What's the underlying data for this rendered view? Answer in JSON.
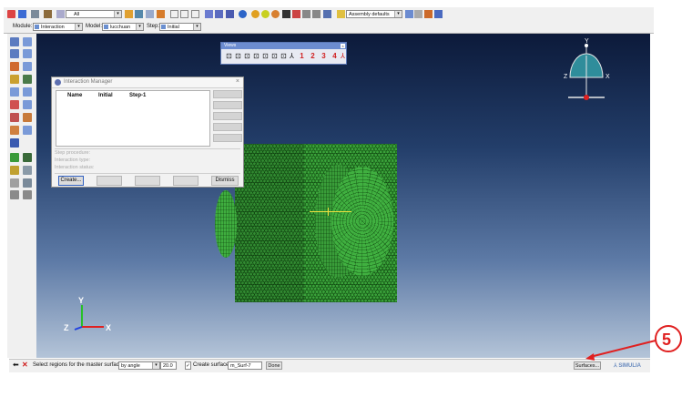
{
  "toolbar": {
    "filter_value": "All",
    "assembly_combo": "Assembly defaults"
  },
  "context_bar": {
    "module_label": "Module:",
    "module_value": "Interaction",
    "model_label": "Model:",
    "model_value": "lucchuan",
    "step_label": "Step:",
    "step_value": "Initial"
  },
  "views_toolbar": {
    "title": "Views",
    "buttons": [
      "1",
      "2",
      "3",
      "4"
    ]
  },
  "interaction_manager": {
    "title": "Interaction Manager",
    "columns": [
      "Name",
      "Initial",
      "Step-1"
    ],
    "step_procedure_label": "Step procedure:",
    "interaction_type_label": "Interaction type:",
    "interaction_status_label": "Interaction status:",
    "create_label": "Create...",
    "dismiss_label": "Dismiss"
  },
  "triad": {
    "x": "X",
    "y": "Y",
    "z": "Z"
  },
  "view_cube": {
    "x": "X",
    "y": "Y",
    "z": "Z"
  },
  "prompt_bar": {
    "message": "Select regions for the master surface",
    "method_value": "by angle",
    "angle_value": "20.0",
    "create_surface_label": "Create surface:",
    "surface_name": "m_Surf-7",
    "done_label": "Done",
    "surfaces_label": "Surfaces..."
  },
  "annotation": {
    "number": "5"
  },
  "brand": {
    "name": "SIMULIA"
  },
  "colors": {
    "mesh_green": "#3aa23a",
    "annotation_red": "#e02020",
    "viewport_top": "#0c1a3a",
    "viewport_bottom": "#b4c4d8"
  }
}
